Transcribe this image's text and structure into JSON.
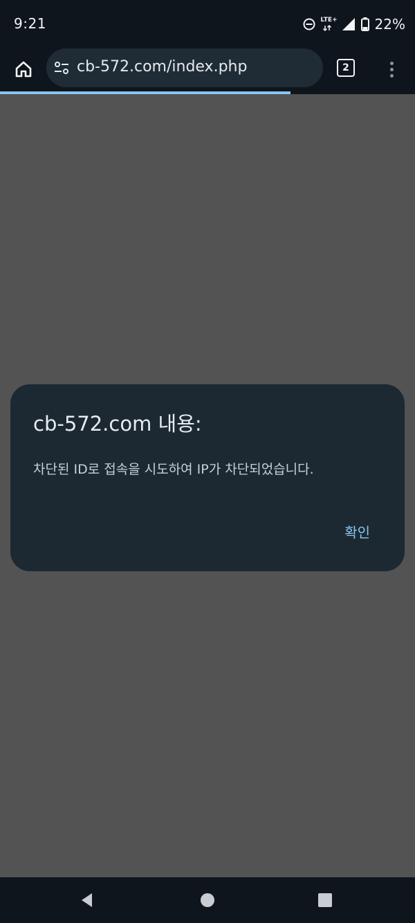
{
  "status_bar": {
    "time": "9:21",
    "network_label": "LTE+",
    "battery_percent": "22%"
  },
  "toolbar": {
    "url": "cb-572.com/index.php",
    "tab_count": "2"
  },
  "page_load_progress": 0.7,
  "dialog": {
    "title": "cb-572.com 내용:",
    "message": "차단된 ID로 접속을 시도하여 IP가 차단되었습니다.",
    "confirm_label": "확인"
  },
  "colors": {
    "accent": "#8ac4ef",
    "chrome_bg": "#0f151c",
    "omnibox_bg": "#1f2c36",
    "dialog_bg": "#1c2933",
    "scrim": "#535353"
  }
}
